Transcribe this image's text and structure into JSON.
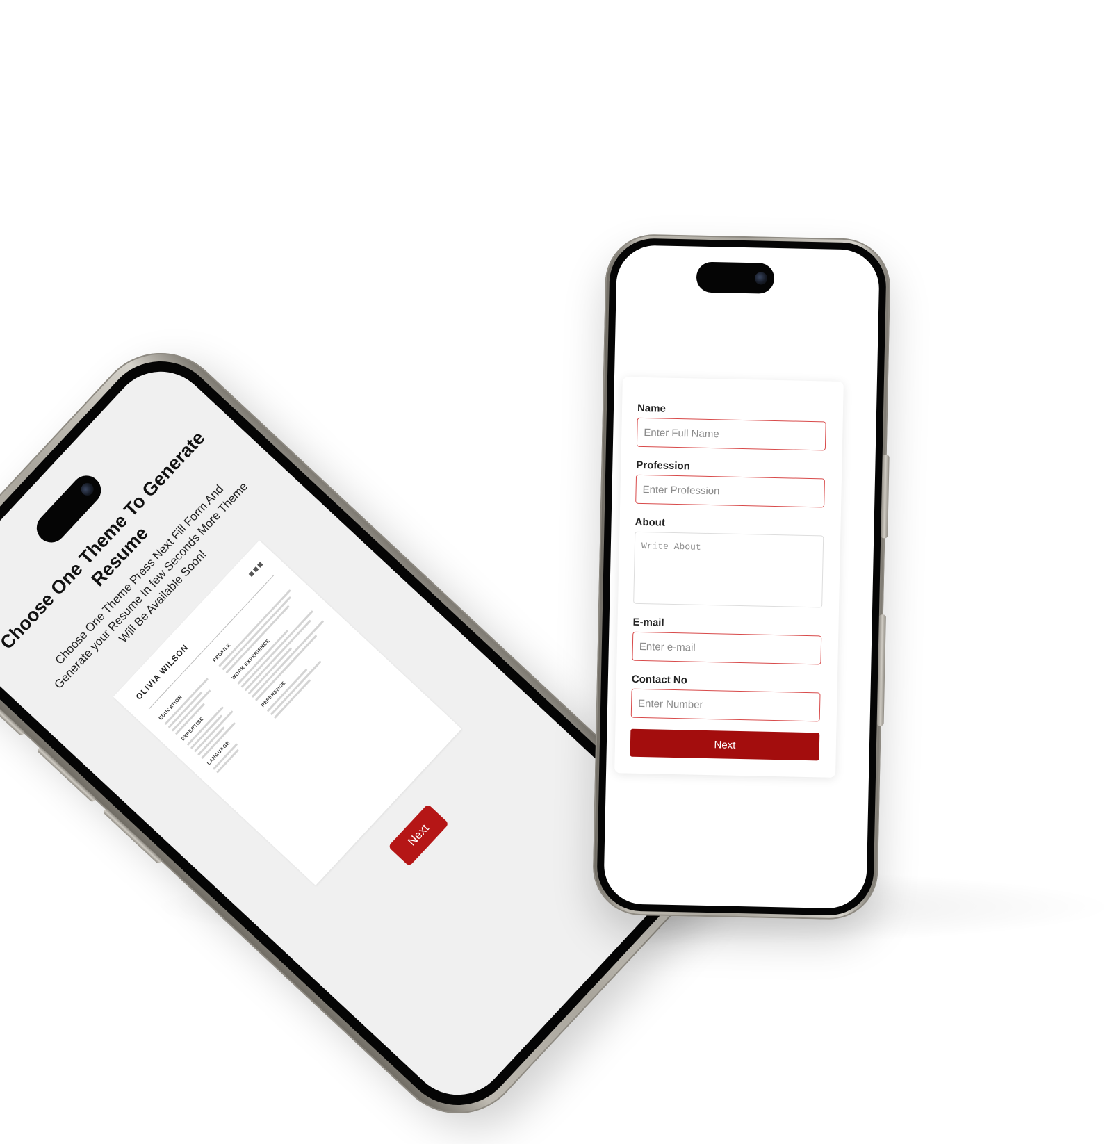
{
  "left_screen": {
    "title": "Choose One Theme To Generate Resume",
    "description": "Choose One Theme Press Next Fill Form And Generate your Resume In few Seconds More Theme Will Be Available Soon!",
    "resume_preview": {
      "name": "OLIVIA WILSON",
      "sections": [
        "EDUCATION",
        "EXPERTISE",
        "LANGUAGE",
        "PROFILE",
        "WORK EXPERIENCE",
        "REFERENCE"
      ]
    },
    "next_label": "Next",
    "accent_color": "#b51616"
  },
  "right_screen": {
    "form": {
      "name_label": "Name",
      "name_placeholder": "Enter Full Name",
      "profession_label": "Profession",
      "profession_placeholder": "Enter Profession",
      "about_label": "About",
      "about_placeholder": "Write About",
      "email_label": "E-mail",
      "email_placeholder": "Enter e-mail",
      "contact_label": "Contact No",
      "contact_placeholder": "Enter Number",
      "next_label": "Next"
    },
    "accent_color": "#a30d0d"
  }
}
